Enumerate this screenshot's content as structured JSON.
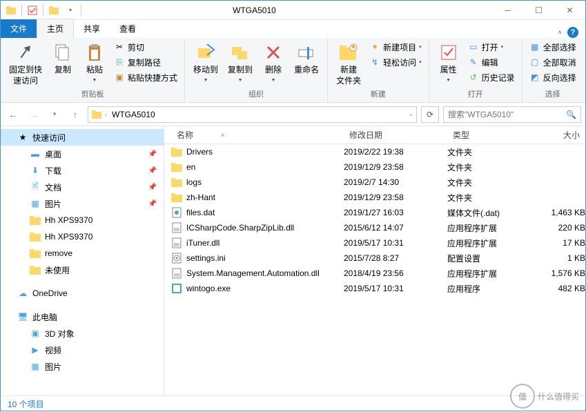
{
  "window": {
    "title": "WTGA5010"
  },
  "tabs": {
    "file": "文件",
    "home": "主页",
    "share": "共享",
    "view": "查看"
  },
  "ribbon": {
    "clipboard": {
      "label": "剪贴板",
      "pin": "固定到快\n速访问",
      "copy": "复制",
      "paste": "粘贴",
      "cut": "剪切",
      "copypath": "复制路径",
      "pasteshortcut": "粘贴快捷方式"
    },
    "organize": {
      "label": "组织",
      "moveto": "移动到",
      "copyto": "复制到",
      "delete": "删除",
      "rename": "重命名"
    },
    "new": {
      "label": "新建",
      "newfolder": "新建\n文件夹",
      "newitem": "新建项目",
      "easyaccess": "轻松访问"
    },
    "open": {
      "label": "打开",
      "properties": "属性",
      "open": "打开",
      "edit": "编辑",
      "history": "历史记录"
    },
    "select": {
      "label": "选择",
      "selectall": "全部选择",
      "selectnone": "全部取消",
      "invert": "反向选择"
    }
  },
  "address": {
    "crumb": "WTGA5010",
    "search_placeholder": "搜索\"WTGA5010\""
  },
  "sidebar": {
    "quick": "快速访问",
    "desktop": "桌面",
    "downloads": "下载",
    "documents": "文档",
    "pictures": "图片",
    "xps1": "Hh XPS9370",
    "xps2": "Hh XPS9370",
    "remove": "remove",
    "unused": "未使用",
    "onedrive": "OneDrive",
    "thispc": "此电脑",
    "obj3d": "3D 对象",
    "videos": "视频",
    "pictures2": "图片"
  },
  "columns": {
    "name": "名称",
    "date": "修改日期",
    "type": "类型",
    "size": "大小"
  },
  "files": [
    {
      "icon": "folder",
      "name": "Drivers",
      "date": "2019/2/22 19:38",
      "type": "文件夹",
      "size": ""
    },
    {
      "icon": "folder",
      "name": "en",
      "date": "2019/12/9 23:58",
      "type": "文件夹",
      "size": ""
    },
    {
      "icon": "folder",
      "name": "logs",
      "date": "2019/2/7 14:30",
      "type": "文件夹",
      "size": ""
    },
    {
      "icon": "folder",
      "name": "zh-Hant",
      "date": "2019/12/9 23:58",
      "type": "文件夹",
      "size": ""
    },
    {
      "icon": "dat",
      "name": "files.dat",
      "date": "2019/1/27 16:03",
      "type": "媒体文件(.dat)",
      "size": "1,463 KB"
    },
    {
      "icon": "dll",
      "name": "ICSharpCode.SharpZipLib.dll",
      "date": "2015/6/12 14:07",
      "type": "应用程序扩展",
      "size": "220 KB"
    },
    {
      "icon": "dll",
      "name": "iTuner.dll",
      "date": "2019/5/17 10:31",
      "type": "应用程序扩展",
      "size": "17 KB"
    },
    {
      "icon": "ini",
      "name": "settings.ini",
      "date": "2015/7/28 8:27",
      "type": "配置设置",
      "size": "1 KB"
    },
    {
      "icon": "dll",
      "name": "System.Management.Automation.dll",
      "date": "2018/4/19 23:56",
      "type": "应用程序扩展",
      "size": "1,576 KB"
    },
    {
      "icon": "exe",
      "name": "wintogo.exe",
      "date": "2019/5/17 10:31",
      "type": "应用程序",
      "size": "482 KB"
    }
  ],
  "statusbar": {
    "count": "10 个项目"
  },
  "watermark": {
    "text": "什么值得买",
    "mark": "值"
  }
}
